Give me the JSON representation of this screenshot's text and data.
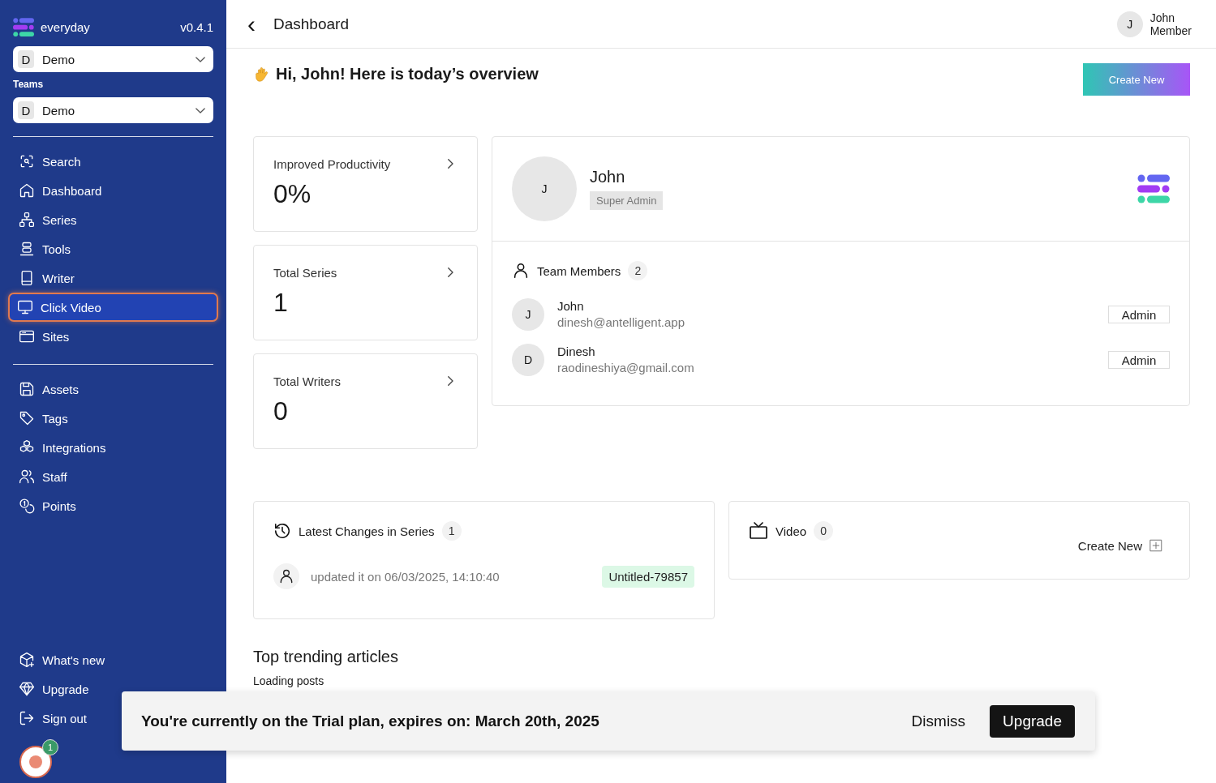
{
  "sidebar": {
    "brand": "everyday",
    "version": "v0.4.1",
    "workspace": {
      "initial": "D",
      "name": "Demo"
    },
    "teams_label": "Teams",
    "team": {
      "initial": "D",
      "name": "Demo"
    },
    "nav_groups": [
      [
        {
          "label": "Search",
          "kind": "search",
          "selected": false
        },
        {
          "label": "Dashboard",
          "kind": "home",
          "selected": false
        },
        {
          "label": "Series",
          "kind": "hierarchy",
          "selected": false
        },
        {
          "label": "Tools",
          "kind": "stack",
          "selected": false
        },
        {
          "label": "Writer",
          "kind": "book",
          "selected": false
        },
        {
          "label": "Click Video",
          "kind": "monitor",
          "selected": true
        },
        {
          "label": "Sites",
          "kind": "browser",
          "selected": false
        }
      ],
      [
        {
          "label": "Assets",
          "kind": "floppy",
          "selected": false
        },
        {
          "label": "Tags",
          "kind": "tag",
          "selected": false
        },
        {
          "label": "Integrations",
          "kind": "cubes",
          "selected": false
        },
        {
          "label": "Staff",
          "kind": "users",
          "selected": false
        },
        {
          "label": "Points",
          "kind": "coins",
          "selected": false
        }
      ]
    ],
    "bottom_items": [
      {
        "label": "What's new",
        "kind": "package",
        "selected": false
      },
      {
        "label": "Upgrade",
        "kind": "diamond",
        "selected": false
      },
      {
        "label": "Sign out",
        "kind": "signout",
        "selected": false
      }
    ]
  },
  "header": {
    "back": "‹",
    "title": "Dashboard",
    "user": {
      "initial": "J",
      "name": "John",
      "role": "Member"
    }
  },
  "greeting": "Hi, John! Here is today’s overview",
  "create_button": "Create New",
  "stats": [
    {
      "label": "Improved Productivity",
      "value": "0%"
    },
    {
      "label": "Total Series",
      "value": "1"
    },
    {
      "label": "Total Writers",
      "value": "0"
    }
  ],
  "profile": {
    "initial": "J",
    "name": "John",
    "role": "Super Admin",
    "members_title": "Team Members",
    "members_count": "2",
    "members": [
      {
        "initial": "J",
        "name": "John",
        "email": "dinesh@antelligent.app",
        "role": "Admin"
      },
      {
        "initial": "D",
        "name": "Dinesh",
        "email": "raodineshiya@gmail.com",
        "role": "Admin"
      }
    ]
  },
  "latest_changes": {
    "title": "Latest Changes in Series",
    "count": "1",
    "entries": [
      {
        "text": "updated it on 06/03/2025, 14:10:40",
        "tag": "Untitled-79857"
      }
    ]
  },
  "video": {
    "title": "Video",
    "count": "0",
    "create_label": "Create New"
  },
  "trending": {
    "title": "Top trending articles",
    "status": "Loading posts"
  },
  "banner": {
    "message": "You're currently on the Trial plan, expires on: March 20th, 2025",
    "dismiss": "Dismiss",
    "upgrade": "Upgrade"
  },
  "help_button": {
    "badge": "1"
  }
}
